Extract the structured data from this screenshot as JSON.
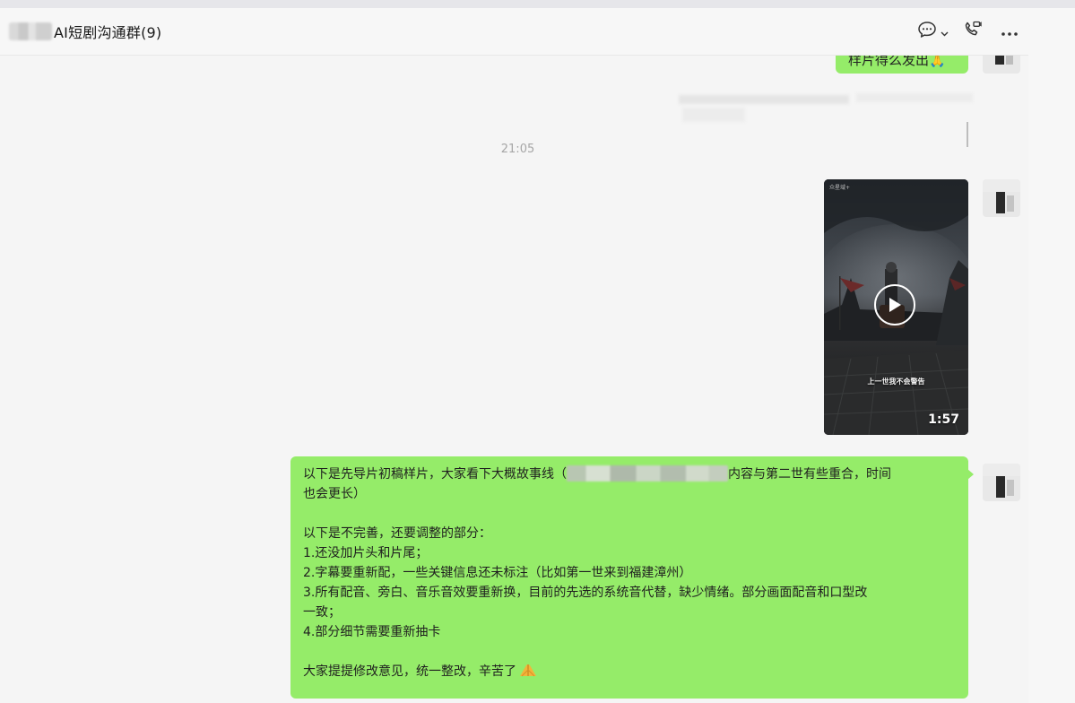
{
  "header": {
    "title": "AI短剧沟通群(9)",
    "icons": [
      "chat-bubble-icon",
      "chevron-down-icon",
      "phone-icon",
      "more-icon"
    ]
  },
  "messages": {
    "top_bubble_text": "样片得么发出🙏",
    "timestamp": "21:05",
    "video": {
      "duration": "1:57",
      "subtitle": "上一世我不会警告",
      "watermark": "众星域+"
    },
    "main_bubble": {
      "lines": [
        "以下是先导片初稿样片，大家看下大概故事线（",
        "内容与第二世有些重合，时间",
        "也会更长）",
        "以下是不完善，还要调整的部分：",
        "1.还没加片头和片尾；",
        "2.字幕要重新配，一些关键信息还未标注（比如第一世来到福建漳州）",
        "3.所有配音、旁白、音乐音效要重新换，目前的先选的系统音代替，缺少情绪。部分画面配音和口型改",
        "一致；",
        "4.部分细节需要重新抽卡",
        "大家提提修改意见，统一整改，辛苦了"
      ]
    }
  },
  "colors": {
    "bubble_green": "#95ec69",
    "background": "#f5f5f5",
    "header_bg": "#f7f7f7"
  }
}
